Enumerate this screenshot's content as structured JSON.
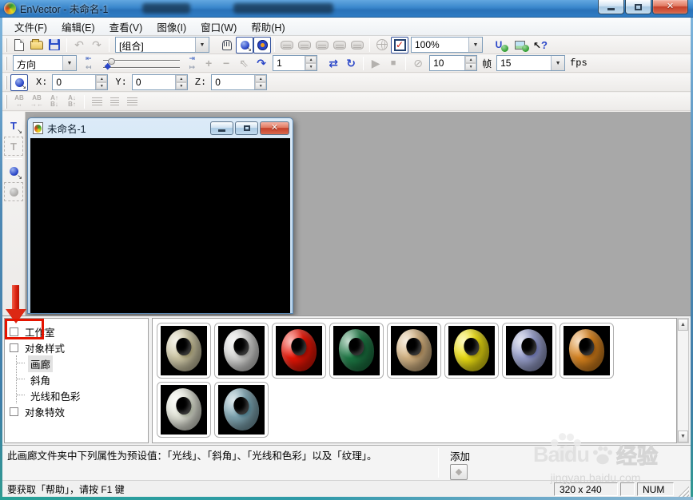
{
  "window": {
    "title": "EnVector - 未命名-1"
  },
  "menu": {
    "items": [
      {
        "key": "file",
        "label": "文件(F)"
      },
      {
        "key": "edit",
        "label": "编辑(E)"
      },
      {
        "key": "view",
        "label": "查看(V)"
      },
      {
        "key": "image",
        "label": "图像(I)"
      },
      {
        "key": "window",
        "label": "窗口(W)"
      },
      {
        "key": "help",
        "label": "帮助(H)"
      }
    ]
  },
  "toolbar_standard": {
    "group_combo": "[组合]",
    "zoom_combo": "100%"
  },
  "toolbar_animation": {
    "direction_combo": "方向",
    "frame_value": "1",
    "length_value": "10",
    "length_unit": "帧",
    "fps_value": "15",
    "fps_unit": "fps"
  },
  "toolbar_position": {
    "x_label": "X:",
    "x_value": "0",
    "y_label": "Y:",
    "y_value": "0",
    "z_label": "Z:",
    "z_value": "0"
  },
  "document_window": {
    "title": "未命名-1"
  },
  "tree": {
    "items": [
      {
        "key": "studio",
        "label": "工作室",
        "expander": "+",
        "depth": 0,
        "highlighted": true
      },
      {
        "key": "object-style",
        "label": "对象样式",
        "expander": "-",
        "depth": 0
      },
      {
        "key": "gallery",
        "label": "画廊",
        "depth": 1,
        "selected": true
      },
      {
        "key": "bevel",
        "label": "斜角",
        "depth": 1
      },
      {
        "key": "light-color",
        "label": "光线和色彩",
        "depth": 1
      },
      {
        "key": "object-fx",
        "label": "对象特效",
        "expander": "+",
        "depth": 0
      }
    ]
  },
  "gallery": {
    "items": [
      {
        "name": "cream-ring",
        "color": "#d6cfac",
        "shadow": "#8d865f"
      },
      {
        "name": "silver-ring",
        "color": "#dddddb",
        "shadow": "#8f8f8d"
      },
      {
        "name": "red-ring",
        "color": "#ee1606",
        "shadow": "#8d0c03"
      },
      {
        "name": "green-ring",
        "color": "#1e7b46",
        "shadow": "#0f4426"
      },
      {
        "name": "gold-ring",
        "color": "#dcba88",
        "shadow": "#8f7046"
      },
      {
        "name": "yellow-ring",
        "color": "#f2e413",
        "shadow": "#95880a"
      },
      {
        "name": "periwinkle-ring",
        "color": "#9ba3d0",
        "shadow": "#5c639a"
      },
      {
        "name": "orange-ring",
        "color": "#dd861e",
        "shadow": "#8a4f0e"
      },
      {
        "name": "pearl-ring",
        "color": "#e9ebdf",
        "shadow": "#9aa08e"
      },
      {
        "name": "steelblue-ring",
        "color": "#83abb8",
        "shadow": "#44707e"
      }
    ]
  },
  "description": {
    "text": "此画廊文件夹中下列属性为预设值：「光线」、「斜角」、「光线和色彩」以及「纹理」。",
    "add_label": "添加"
  },
  "statusbar": {
    "help_text": "要获取「帮助」，请按 F1 键",
    "size_pane": "320 x 240",
    "num_pane": "NUM"
  },
  "watermark": {
    "brand": "Baidu",
    "brand_suffix": "经验",
    "url": "jingyan.baidu.com"
  },
  "icons": {
    "undo": "↶",
    "redo": "↷",
    "dropdown": "▼",
    "spin_up": "▲",
    "spin_down": "▼",
    "check": "✓",
    "help_arrow": "↖",
    "help_q": "?",
    "step_start": "⇤",
    "step_end": "⇥",
    "jump_back": "↤",
    "jump_fwd": "↦",
    "add_key": "+",
    "del_key": "−",
    "clear_keys": "⇖",
    "curve": "↷",
    "loop": "⇄",
    "rotate": "↻",
    "play": "▶",
    "stop": "■",
    "record_off": "⊘",
    "thumb_diamond": "◆",
    "ab_spacing": "AB\n↔",
    "ab_kerning": "AB\n→←",
    "ab_shift_up": "A↑\nB↓",
    "ab_shift_down": "A↓\nB↑",
    "scroll_up": "▲",
    "scroll_down": "▼",
    "gem": "◆",
    "corner_arrow": "↘"
  },
  "colors": {
    "annotation_red": "#e51400",
    "titlebar_blue": "#2f7cc4",
    "mdi_gray": "#a8a8a8"
  }
}
